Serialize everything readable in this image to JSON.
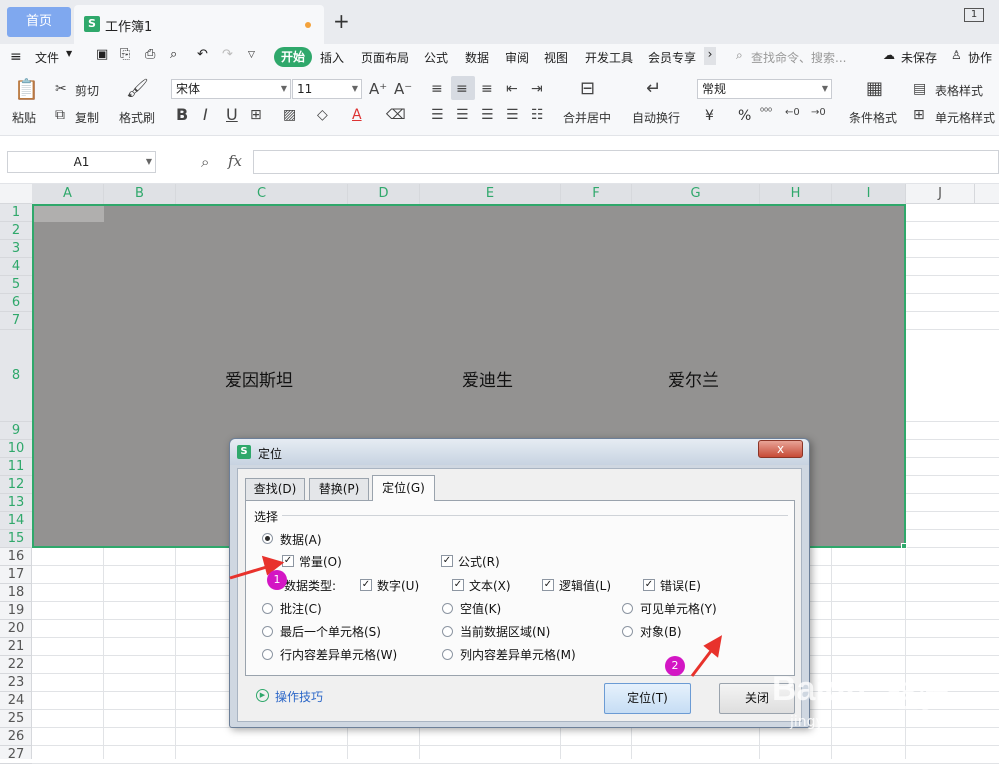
{
  "tabbar": {
    "home": "首页",
    "doc_title": "工作簿1",
    "add": "+",
    "mini_icon": "1"
  },
  "menu": {
    "file": "文件",
    "start": "开始",
    "items": [
      "插入",
      "页面布局",
      "公式",
      "数据",
      "审阅",
      "视图",
      "开发工具",
      "会员专享"
    ],
    "search_placeholder": "查找命令、搜索...",
    "unsaved": "未保存",
    "collab": "协作"
  },
  "ribbon": {
    "paste": "粘贴",
    "cut": "剪切",
    "copy": "复制",
    "format_painter": "格式刷",
    "font_name": "宋体",
    "font_size": "11",
    "merge_center": "合并居中",
    "wrap_text": "自动换行",
    "number_format": "常规",
    "conditional_format": "条件格式",
    "table_style": "表格样式",
    "cell_style": "单元格样式",
    "currency_symbol": "¥",
    "percent_symbol": "%"
  },
  "formula_bar": {
    "name_box": "A1",
    "fx": "fx"
  },
  "grid": {
    "columns": [
      "A",
      "B",
      "C",
      "D",
      "E",
      "F",
      "G",
      "H",
      "I",
      "J"
    ],
    "rows": [
      "1",
      "2",
      "3",
      "4",
      "5",
      "6",
      "7",
      "8",
      "9",
      "10",
      "11",
      "12",
      "13",
      "14",
      "15",
      "16",
      "17",
      "18",
      "19",
      "20",
      "21",
      "22",
      "23",
      "24",
      "25",
      "26",
      "27"
    ],
    "row8_cells": {
      "C": "爱因斯坦",
      "E": "爱迪生",
      "G": "爱尔兰"
    }
  },
  "dialog": {
    "title": "定位",
    "close_icon": "x",
    "tabs": [
      "查找(D)",
      "替换(P)",
      "定位(G)"
    ],
    "group": "选择",
    "opt_data": "数据(A)",
    "opt_constant": "常量(O)",
    "opt_formula": "公式(R)",
    "data_type_label": "数据类型:",
    "type_number": "数字(U)",
    "type_text": "文本(X)",
    "type_logical": "逻辑值(L)",
    "type_error": "错误(E)",
    "opt_comment": "批注(C)",
    "opt_blank": "空值(K)",
    "opt_visible": "可见单元格(Y)",
    "opt_last_cell": "最后一个单元格(S)",
    "opt_current_region": "当前数据区域(N)",
    "opt_object": "对象(B)",
    "opt_row_diff": "行内容差异单元格(W)",
    "opt_col_diff": "列内容差异单元格(M)",
    "tips": "操作技巧",
    "btn_locate": "定位(T)",
    "btn_close": "关闭"
  },
  "annotations": {
    "badge1": "1",
    "badge2": "2"
  },
  "watermark": {
    "brand": "Baidu",
    "brand_cn": "经验",
    "url": "jingyan.baidu.com"
  },
  "colors": {
    "accent": "#2fa86b",
    "selection_fill": "#939291",
    "annotation": "#d316c4"
  }
}
